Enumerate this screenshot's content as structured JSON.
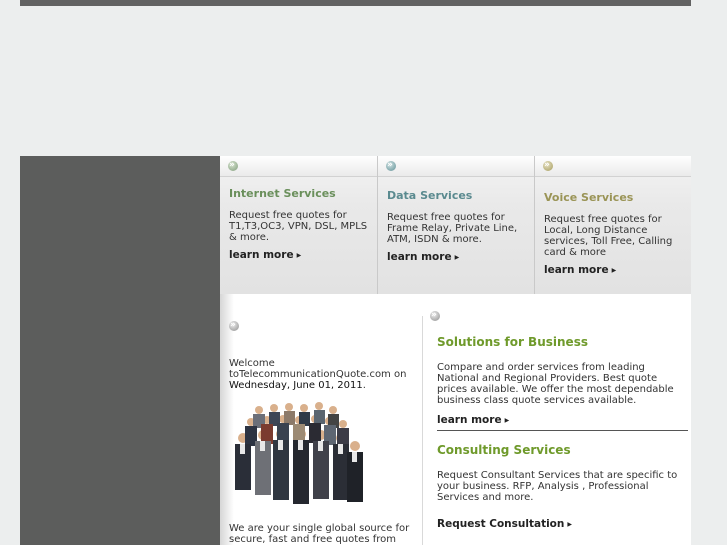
{
  "colors": {
    "topbar": "#626262",
    "sidebar": "#5c5d5c",
    "internet_title": "#6a8f5b",
    "data_title": "#5a8a8f",
    "voice_title": "#9a9456",
    "section_title": "#6f9a2b"
  },
  "services": [
    {
      "title": "Internet Services",
      "description": "Request free quotes for T1,T3,OC3, VPN, DSL, MPLS & more.",
      "learn_more": "learn more",
      "icon": "bullet-arrow-icon"
    },
    {
      "title": "Data Services",
      "description": "Request free quotes for Frame Relay, Private Line, ATM, ISDN & more.",
      "learn_more": "learn more",
      "icon": "bullet-arrow-icon"
    },
    {
      "title": "Voice Services",
      "description": "Request free quotes for Local, Long Distance services, Toll Free, Calling card & more",
      "learn_more": "learn more",
      "icon": "bullet-arrow-icon"
    }
  ],
  "left_panel": {
    "welcome_line1": "Welcome",
    "welcome_line2": "toTelecommunicationQuote.com on",
    "date": "Wednesday, June 01, 2011",
    "date_suffix": ".",
    "intro": "We are your single global source for secure, fast and free quotes from"
  },
  "solutions": {
    "title": "Solutions for Business",
    "description": "Compare and order services from leading National and Regional Providers. Best quote prices available. We offer the most dependable business class quote services available.",
    "learn_more": "learn more"
  },
  "consulting": {
    "title": "Consulting Services",
    "description": "Request Consultant Services that are specific to your business. RFP, Analysis , Professional Services and more.",
    "cta": "Request Consultation"
  }
}
